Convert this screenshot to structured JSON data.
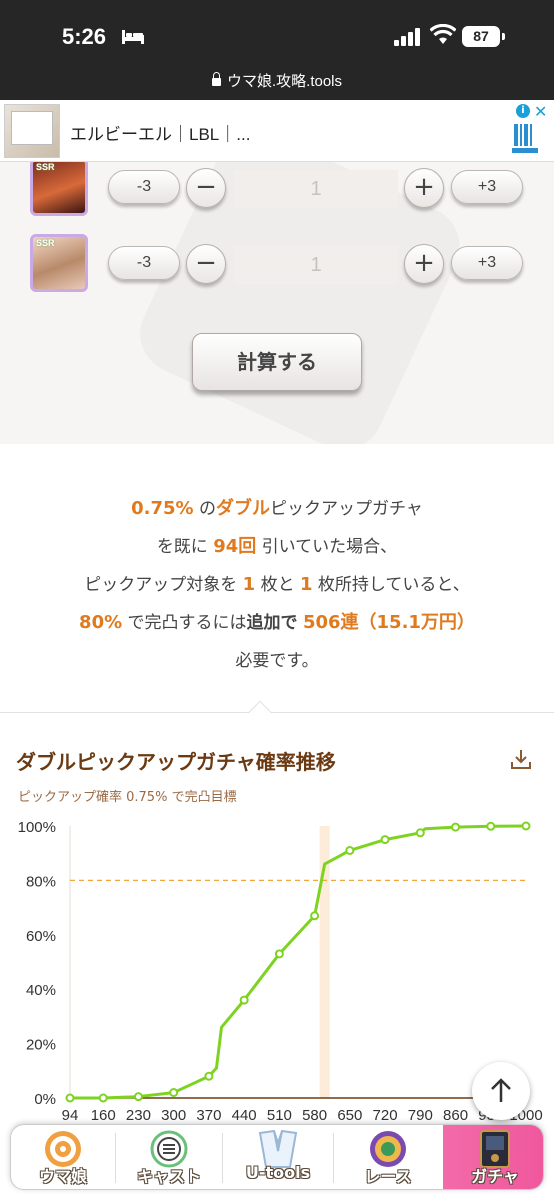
{
  "status_bar": {
    "time": "5:26",
    "battery": "87",
    "url": "ウマ娘.攻略.tools"
  },
  "ad": {
    "text": "エルビーエル｜LBL｜...",
    "info": "i",
    "close": "✕"
  },
  "calculator": {
    "rows": [
      {
        "minus3": "-3",
        "minus": "−",
        "count": "1",
        "plus": "+",
        "plus3": "+3",
        "rarity": "SSR"
      },
      {
        "minus3": "-3",
        "minus": "−",
        "count": "1",
        "plus": "+",
        "plus3": "+3",
        "rarity": "SSR"
      }
    ],
    "calc_button": "計算する"
  },
  "result": {
    "rate": "0.75%",
    "t1": " の",
    "gacha_type": "ダブル",
    "t2": "ピックアップガチャ",
    "t3": "を既に ",
    "pulls": "94回",
    "t4": " 引いていた場合、",
    "t5": "ピックアップ対象を ",
    "own1": "1",
    "t6": " 枚と ",
    "own2": "1",
    "t7": " 枚所持していると、",
    "prob": "80%",
    "t8": " で完凸するには",
    "t9": "追加で",
    "t10": " ",
    "needed": "506連（15.1万円）",
    "t11": "必要です。"
  },
  "chart_section": {
    "title": "ダブルピックアップガチャ確率推移",
    "subtitle": "ピックアップ確率 0.75% で完凸目標",
    "download_icon": "download-icon"
  },
  "chart_data": {
    "type": "line",
    "title": "ダブルピックアップガチャ確率推移",
    "x_tick_labels": [
      "94",
      "160",
      "230",
      "300",
      "370",
      "440",
      "510",
      "580",
      "650",
      "720",
      "790",
      "860",
      "930",
      "1000"
    ],
    "y_tick_labels": [
      "0%",
      "20%",
      "40%",
      "60%",
      "80%",
      "100%"
    ],
    "xlim": [
      94,
      1000
    ],
    "ylim": [
      0,
      100
    ],
    "target_line": 80,
    "highlight_x": 600,
    "series": [
      {
        "color": "#7ed321",
        "x": [
          94,
          160,
          230,
          300,
          370,
          385,
          395,
          440,
          510,
          580,
          600,
          650,
          720,
          790,
          800,
          860,
          930,
          1000
        ],
        "y": [
          0,
          0,
          0.5,
          2,
          8,
          11,
          26,
          36,
          53,
          67,
          86,
          91,
          95,
          97.5,
          99,
          99.6,
          99.9,
          100
        ],
        "marker_x": [
          94,
          160,
          230,
          300,
          370,
          440,
          510,
          580,
          650,
          720,
          790,
          860,
          930,
          1000
        ],
        "marker_y": [
          0,
          0,
          0.5,
          2,
          8,
          36,
          53,
          67,
          91,
          95,
          97.5,
          99.6,
          99.9,
          100
        ]
      }
    ]
  },
  "nav": {
    "items": [
      {
        "label": "ウマ娘"
      },
      {
        "label": "キャスト"
      },
      {
        "label": "U-tools"
      },
      {
        "label": "レース"
      },
      {
        "label": "ガチャ"
      }
    ]
  },
  "colors": {
    "accent": "#e07a1f",
    "line": "#7ed321",
    "title": "#6b3a12",
    "nav_active": "#f26aa9"
  }
}
